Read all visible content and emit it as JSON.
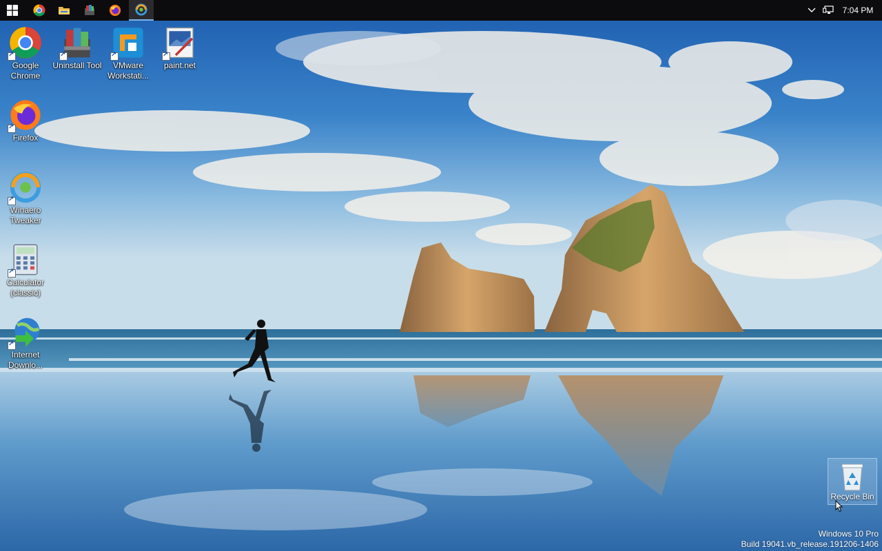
{
  "taskbar": {
    "pinned": [
      {
        "name": "start",
        "icon": "windows-logo-icon"
      },
      {
        "name": "chrome",
        "icon": "chrome-icon"
      },
      {
        "name": "file-explorer",
        "icon": "folder-icon"
      },
      {
        "name": "uninstall-tool",
        "icon": "uninstall-tool-icon"
      },
      {
        "name": "firefox",
        "icon": "firefox-icon"
      },
      {
        "name": "winaero-tweaker",
        "icon": "winaero-tweaker-icon",
        "active": true
      }
    ],
    "clock": "7:04 PM"
  },
  "desktop": {
    "icons": [
      {
        "label": "Google Chrome",
        "icon": "chrome-icon"
      },
      {
        "label": "Uninstall Tool",
        "icon": "uninstall-tool-icon"
      },
      {
        "label": "VMware Workstati...",
        "icon": "vmware-icon"
      },
      {
        "label": "paint.net",
        "icon": "paintnet-icon"
      },
      {
        "label": "Firefox",
        "icon": "firefox-icon"
      },
      {
        "label": "Winaero Tweaker",
        "icon": "winaero-tweaker-icon"
      },
      {
        "label": "Calculator (classic)",
        "icon": "calculator-icon"
      },
      {
        "label": "Internet Downlo...",
        "icon": "internet-download-manager-icon"
      }
    ],
    "recycle_bin": {
      "label": "Recycle Bin",
      "icon": "recycle-bin-icon"
    }
  },
  "watermark": {
    "edition": "Windows 10 Pro",
    "build": "Build 19041.vb_release.191206-1406"
  },
  "colors": {
    "taskbar": "#0c0c0e",
    "accent": "#7db3e8",
    "sky_top": "#1d5fae",
    "sea": "#2f7fa8"
  }
}
